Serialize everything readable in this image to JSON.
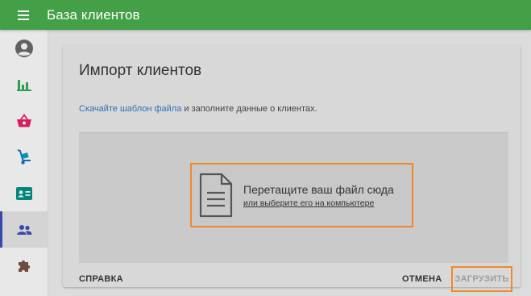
{
  "header": {
    "title": "База клиентов",
    "menu_icon": "hamburger-menu-icon"
  },
  "sidebar": {
    "items": [
      {
        "name": "account",
        "icon": "account-circle-icon",
        "active": false
      },
      {
        "name": "statistics",
        "icon": "bar-chart-icon",
        "active": false
      },
      {
        "name": "shop",
        "icon": "basket-icon",
        "active": false
      },
      {
        "name": "delivery",
        "icon": "hand-truck-icon",
        "active": false
      },
      {
        "name": "cards",
        "icon": "contact-card-icon",
        "active": false
      },
      {
        "name": "clients",
        "icon": "people-icon",
        "active": true
      },
      {
        "name": "extensions",
        "icon": "puzzle-icon",
        "active": false
      }
    ]
  },
  "import_card": {
    "title": "Импорт клиентов",
    "template_link": "Скачайте шаблон файла",
    "description_rest": " и заполните данные о клиентах.",
    "dropzone": {
      "primary": "Перетащите ваш файл сюда",
      "secondary": "или выберите его на компьютере"
    },
    "actions": {
      "help": "СПРАВКА",
      "cancel": "ОТМЕНА",
      "upload": "ЗАГРУЗИТЬ"
    }
  },
  "colors": {
    "header": "#43a047",
    "active_indicator": "#3949ab",
    "highlight": "#ef8a2b",
    "link": "#2f6fb5"
  }
}
